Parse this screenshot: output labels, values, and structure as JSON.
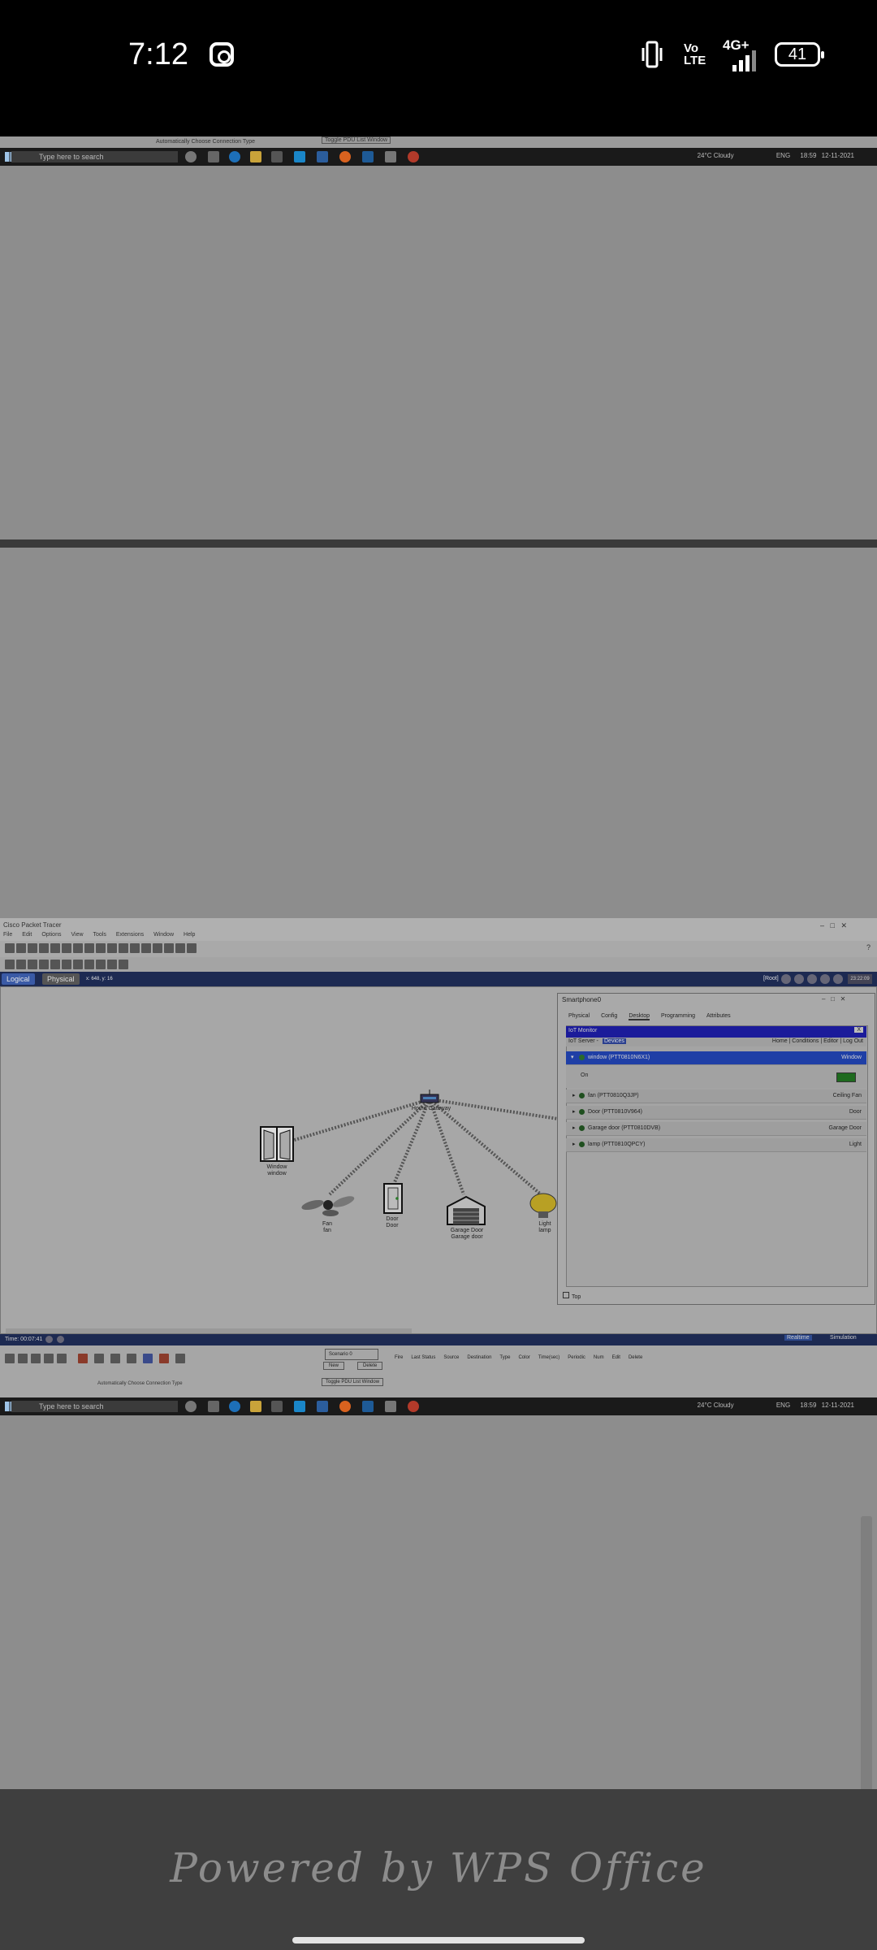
{
  "status_bar": {
    "time": "7:12",
    "network": "4G+",
    "volte": "Vo LTE",
    "battery": "41",
    "icons": [
      "instagram-icon",
      "vibrate-icon",
      "signal-icon",
      "battery-icon"
    ]
  },
  "top_strip": {
    "connection_label": "Automatically Choose Connection Type",
    "toggle_pdu": "Toggle PDU List Window",
    "search_placeholder": "Type here to search",
    "weather": "24°C  Cloudy",
    "lang": "ENG",
    "time": "18:59",
    "date": "12-11-2021"
  },
  "packet_tracer": {
    "title": "Cisco Packet Tracer",
    "menu": [
      "File",
      "Edit",
      "Options",
      "View",
      "Tools",
      "Extensions",
      "Window",
      "Help"
    ],
    "tabs": {
      "logical": "Logical",
      "physical": "Physical",
      "coords": "x: 648, y: 16"
    },
    "root": "[Root]",
    "devices": {
      "gateway": "Home Gateway",
      "window": "Window\nwindow",
      "fan": "Fan\nfan",
      "door": "Door\nDoor",
      "garage": "Garage Door\nGarage door",
      "light": "Light\nlamp"
    },
    "time_label": "Time: 00:07:41",
    "realtime": "Realtime",
    "simulation": "Simulation",
    "scenario": "Scenario 0",
    "new": "New",
    "delete": "Delete",
    "toggle_pdu": "Toggle PDU List Window",
    "connection_label": "Automatically Choose Connection Type",
    "table_headers": [
      "Fire",
      "Last Status",
      "Source",
      "Destination",
      "Type",
      "Color",
      "Time(sec)",
      "Periodic",
      "Num",
      "Edit",
      "Delete"
    ]
  },
  "smartphone_dialog": {
    "title": "Smartphone0",
    "tabs": [
      "Physical",
      "Config",
      "Desktop",
      "Programming",
      "Attributes"
    ],
    "header": "IoT Monitor",
    "close": "X",
    "server": "IoT Server - ",
    "server_user": "Devices",
    "nav": "Home | Conditions | Editor | Log Out",
    "rows": [
      {
        "name": "window (PTT0810N6X1)",
        "type": "Window"
      },
      {
        "name": "fan (PTT0810Q3JP)",
        "type": "Ceiling Fan"
      },
      {
        "name": "Door (PTT0810V964)",
        "type": "Door"
      },
      {
        "name": "Garage door (PTT0810DVB)",
        "type": "Garage Door"
      },
      {
        "name": "lamp (PTT0810QPCY)",
        "type": "Light"
      }
    ],
    "on_label": "On",
    "top_checkbox": "Top"
  },
  "bottom_strip": {
    "search_placeholder": "Type here to search",
    "weather": "24°C  Cloudy",
    "lang": "ENG",
    "time": "18:59",
    "date": "12-11-2021"
  },
  "footer": {
    "wps": "Powered by WPS Office"
  }
}
